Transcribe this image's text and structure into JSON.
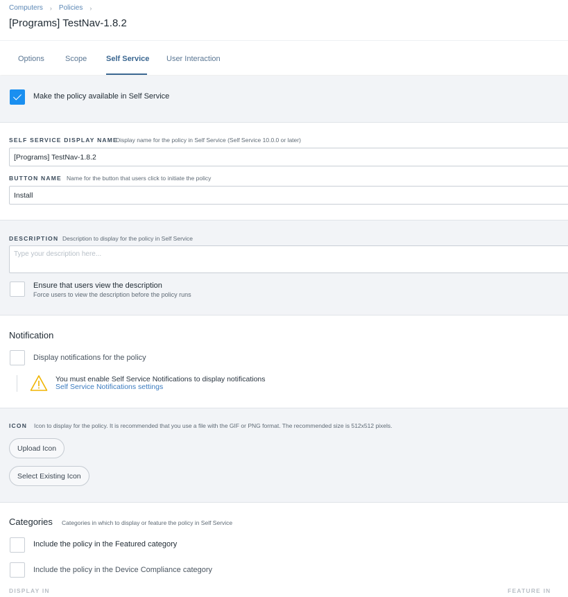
{
  "breadcrumb": {
    "items": [
      "Computers",
      "Policies"
    ]
  },
  "page_title": "[Programs] TestNav-1.8.2",
  "tabs": [
    {
      "label": "Options"
    },
    {
      "label": "Scope"
    },
    {
      "label": "Self Service",
      "active": true
    },
    {
      "label": "User Interaction"
    }
  ],
  "availability": {
    "label": "Make the policy available in Self Service",
    "checked": true
  },
  "display_name": {
    "label": "SELF SERVICE DISPLAY NAME",
    "hint": "Display name for the policy in Self Service (Self Service 10.0.0 or later)",
    "value": "[Programs] TestNav-1.8.2"
  },
  "button_name": {
    "label": "BUTTON NAME",
    "hint": "Name for the button that users click to initiate the policy",
    "value": "Install"
  },
  "description": {
    "label": "DESCRIPTION",
    "hint": "Description to display for the policy in Self Service",
    "placeholder": "Type your description here...",
    "ensure_label": "Ensure that users view the description",
    "ensure_sub": "Force users to view the description before the policy runs"
  },
  "notification": {
    "heading": "Notification",
    "checkbox_label": "Display notifications for the policy",
    "warning_text": "You must enable Self Service Notifications to display notifications",
    "warning_link": "Self Service Notifications settings",
    "warning_color": "#f0b400"
  },
  "icon_section": {
    "label": "ICON",
    "hint": "Icon to display for the policy. It is recommended that you use a file with the GIF or PNG format. The recommended size is 512x512 pixels.",
    "upload_button": "Upload Icon",
    "select_button": "Select Existing Icon"
  },
  "categories": {
    "heading": "Categories",
    "hint": "Categories in which to display or feature the policy in Self Service",
    "featured_label": "Include the policy in the Featured category",
    "compliance_label": "Include the policy in the Device Compliance category",
    "col_display_in": "DISPLAY IN",
    "col_feature_in": "FEATURE IN"
  },
  "colors": {
    "accent": "#1a8ff0",
    "link": "#3b7bbf",
    "active_tab": "#3b6791",
    "section_gray": "#f2f4f7"
  }
}
